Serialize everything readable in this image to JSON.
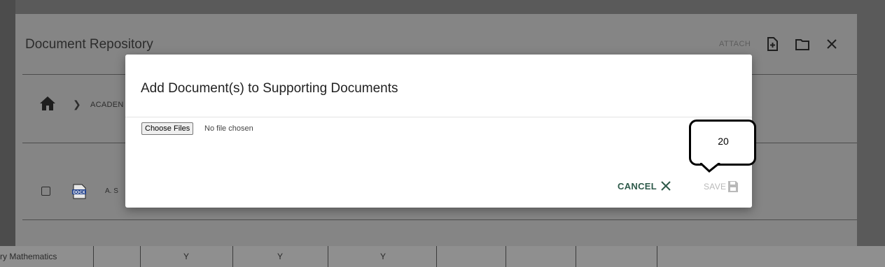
{
  "background": {
    "table_row": {
      "subject": "ry Mathematics",
      "cells": [
        "Y",
        "Y",
        "Y"
      ]
    }
  },
  "repository": {
    "title": "Document Repository",
    "attach_label": "ATTACH",
    "breadcrumb": {
      "item": "ACADEN"
    },
    "file_row": {
      "name": "A. S"
    }
  },
  "modal": {
    "title": "Add Document(s) to Supporting Documents",
    "choose_files_label": "Choose Files",
    "no_file_text": "No file chosen",
    "cancel_label": "CANCEL",
    "save_label": "SAVE"
  },
  "callout": {
    "number": "20"
  },
  "colors": {
    "overlay": "#858585",
    "cancel": "#2e5a4a",
    "save_disabled": "#b9b9b9",
    "modal_bg": "#ffffff"
  }
}
